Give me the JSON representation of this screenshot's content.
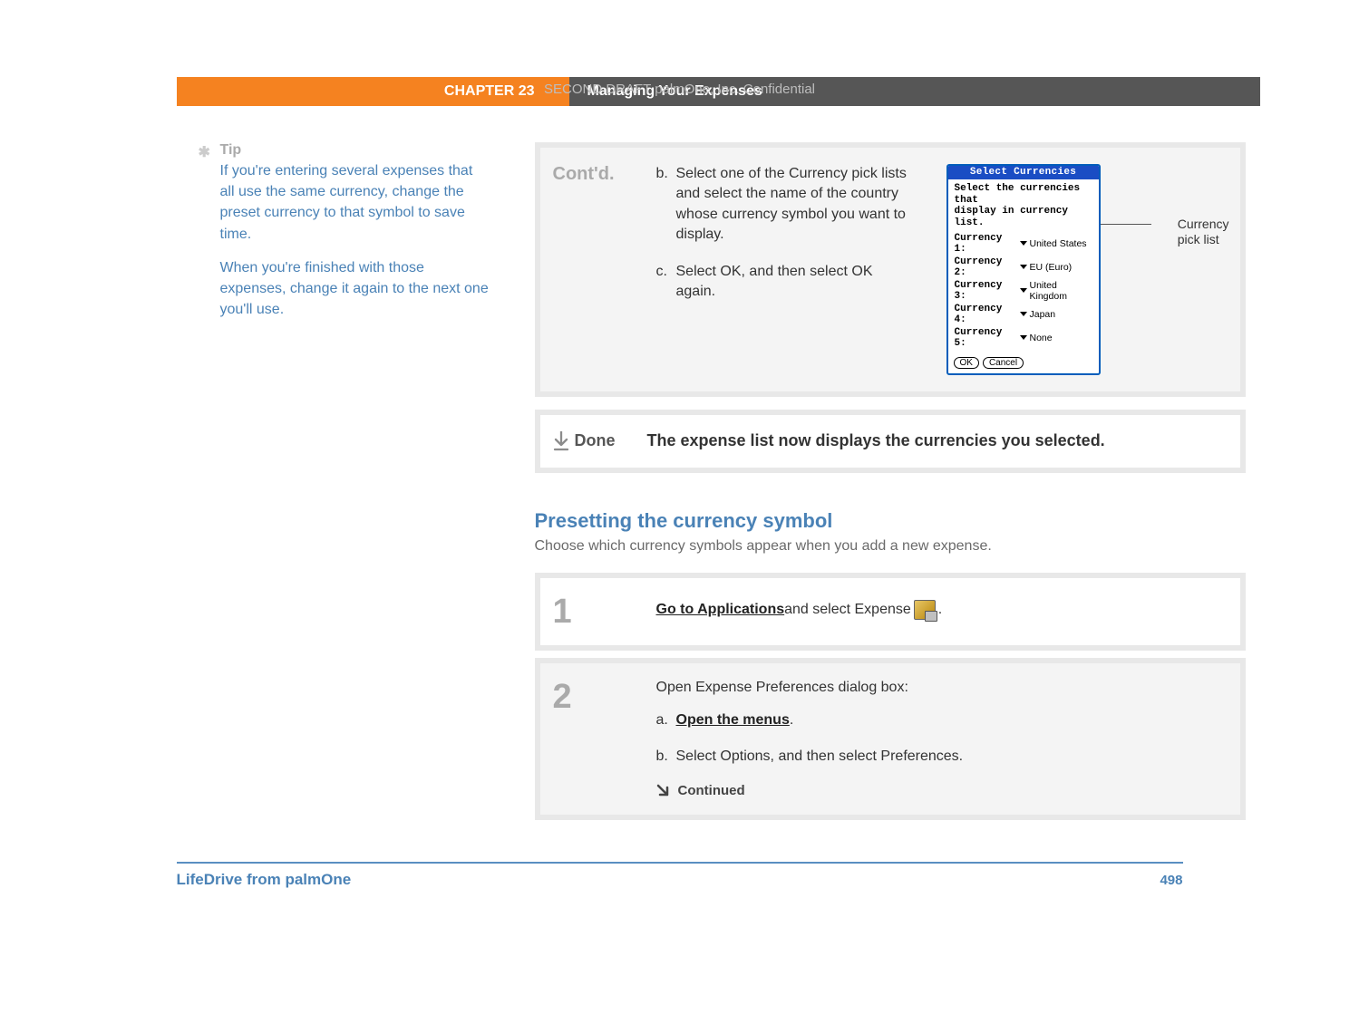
{
  "conf": "SECOND DRAFT palmOne, Inc.  Confidential",
  "banner": {
    "chapter": "CHAPTER 23",
    "title": "Managing Your Expenses"
  },
  "tip": {
    "label": "Tip",
    "p1": "If you're entering several expenses that all use the same currency, change the preset currency to that symbol to save time.",
    "p2": "When you're finished with those expenses, change it again to the next one you'll use."
  },
  "contd": {
    "label": "Cont'd.",
    "b_letter": "b.",
    "b_text": "Select one of the Currency pick lists and select the name of the country whose currency symbol you want to display.",
    "c_letter": "c.",
    "c_text": "Select OK, and then select OK again.",
    "callout_l1": "Currency",
    "callout_l2": "pick list",
    "shot": {
      "title": "Select Currencies",
      "msg_l1": "Select the currencies that",
      "msg_l2": "display in currency list.",
      "rows": [
        {
          "lbl": "Currency 1:",
          "val": "United States"
        },
        {
          "lbl": "Currency 2:",
          "val": "EU (Euro)"
        },
        {
          "lbl": "Currency 3:",
          "val": "United Kingdom"
        },
        {
          "lbl": "Currency 4:",
          "val": "Japan"
        },
        {
          "lbl": "Currency 5:",
          "val": "None"
        }
      ],
      "ok": "OK",
      "cancel": "Cancel"
    }
  },
  "done": {
    "label": "Done",
    "text": "The expense list now displays the currencies you selected."
  },
  "section": {
    "heading": "Presetting the currency symbol",
    "sub": "Choose which currency symbols appear when you add a new expense."
  },
  "step1": {
    "num": "1",
    "link": "Go to Applications",
    "after_link": " and select Expense ",
    "period": "."
  },
  "step2": {
    "num": "2",
    "intro": "Open Expense Preferences dialog box:",
    "a_letter": "a.",
    "a_link": "Open the menus",
    "a_after": ".",
    "b_letter": "b.",
    "b_text": "Select Options, and then select Preferences.",
    "continued": "Continued"
  },
  "footer": {
    "prod": "LifeDrive from palmOne",
    "page": "498"
  }
}
